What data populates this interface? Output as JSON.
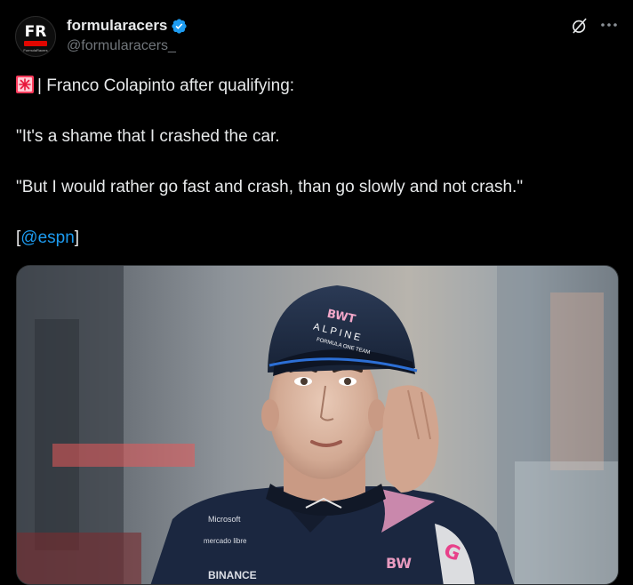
{
  "post": {
    "author": {
      "display_name": "formularacers",
      "handle": "@formularacers_",
      "avatar_text": "FR",
      "avatar_subtext": "FormulaRacers",
      "verified": true
    },
    "text": {
      "line1_emoji_icon": "rotating-light-icon",
      "line1": "| Franco Colapinto after qualifying:",
      "line2": "\"It's a shame that I crashed the car.",
      "line3": "\"But I would rather go fast and crash, than go slowly and not crash.\"",
      "line4_open": "[",
      "mention": "@espn",
      "line4_close": "]"
    },
    "photo": {
      "subject": "driver in Alpine team cap and race suit",
      "cap_brand": "BWT",
      "cap_team": "ALPINE",
      "cap_subtitle": "FORMULA ONE TEAM",
      "suit_sponsor_1": "Microsoft",
      "suit_sponsor_2": "mercado libre",
      "suit_sponsor_3": "BINANCE",
      "suit_sponsor_4": "BWT"
    },
    "icons": {
      "grok": "grok-icon",
      "more": "more-icon",
      "verified": "verified-badge-icon"
    }
  },
  "colors": {
    "background": "#000000",
    "text_primary": "#e7e9ea",
    "text_secondary": "#71767b",
    "link": "#1d9bf0",
    "verified": "#1d9bf0"
  }
}
